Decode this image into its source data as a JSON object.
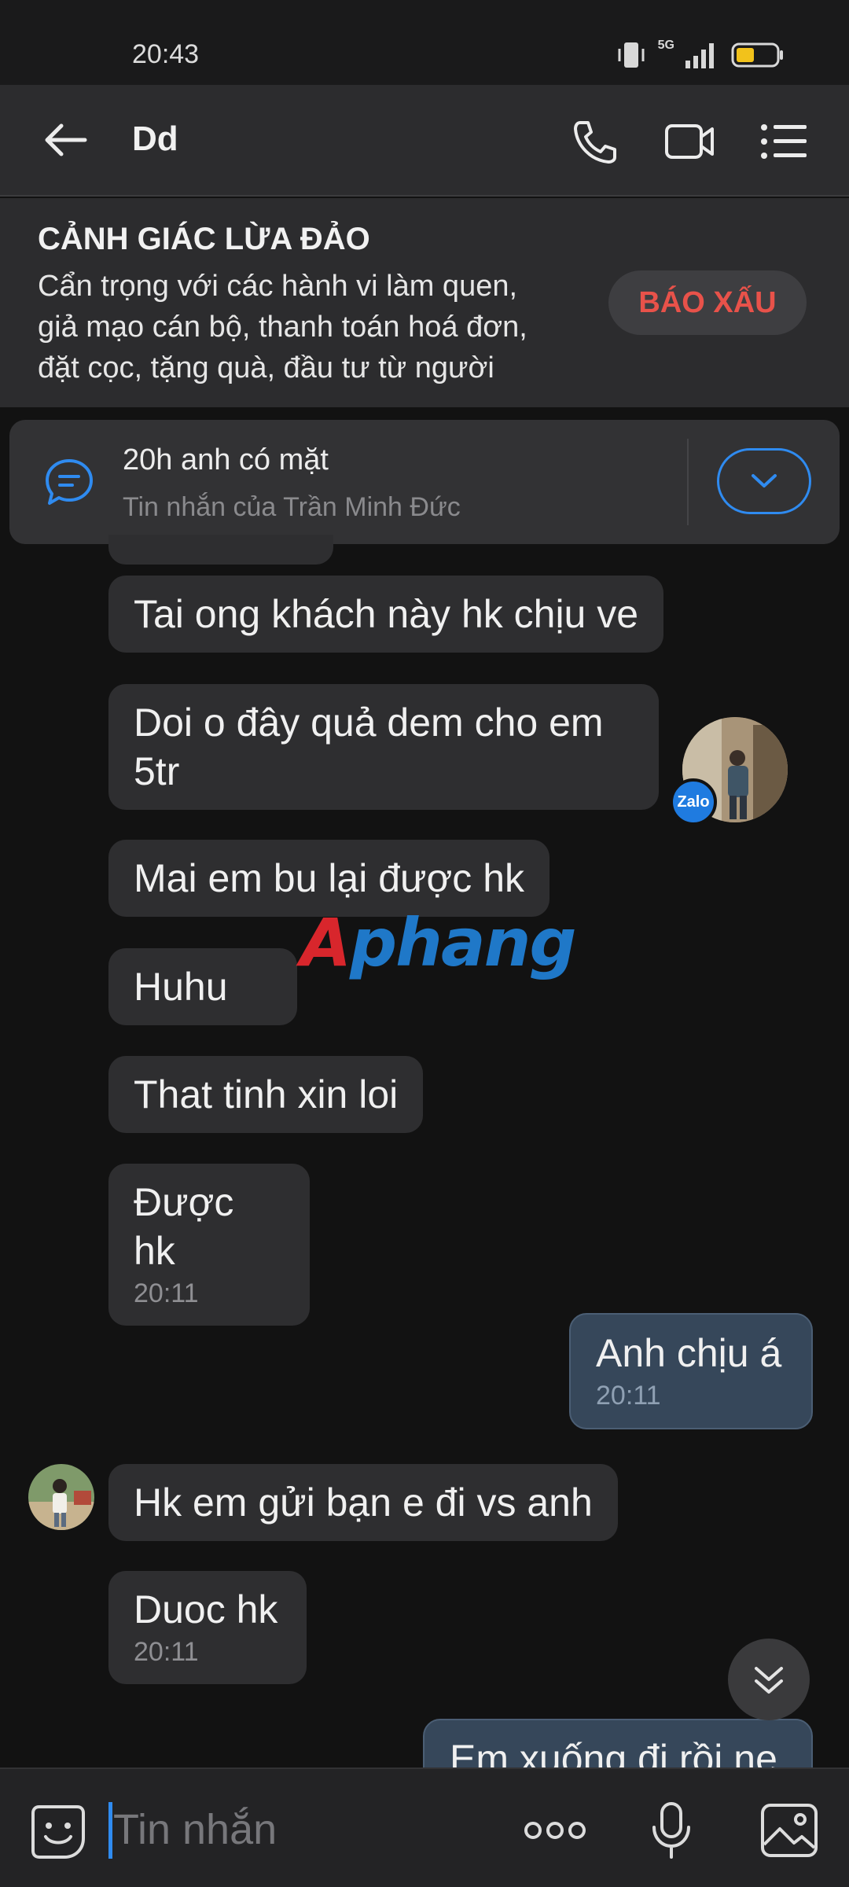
{
  "status_bar": {
    "time": "20:43",
    "network": "5G"
  },
  "header": {
    "title": "Dd"
  },
  "warning": {
    "title": "CẢNH GIÁC LỪA ĐẢO",
    "line1": "Cẩn trọng với các hành vi làm quen,",
    "line2": "giả mạo cán bộ, thanh toán hoá đơn,",
    "line3": "đặt cọc, tặng quà, đầu tư từ người",
    "report_label": "BÁO XẤU"
  },
  "pinned": {
    "title": "20h anh có mặt",
    "subtitle": "Tin nhắn của Trần Minh Đức"
  },
  "messages": [
    {
      "text": "Tai ong khách này hk chịu ve"
    },
    {
      "text": "Doi o đây quả dem cho em",
      "text2": "5tr",
      "badge": "Zalo"
    },
    {
      "text": "Mai em bu lại được hk"
    },
    {
      "text": "Huhu"
    },
    {
      "text": "That tinh xin loi"
    },
    {
      "text": "Được hk",
      "time": "20:11"
    },
    {
      "text": "Anh chịu á",
      "time": "20:11"
    },
    {
      "text": "Hk em gửi bạn e đi vs anh"
    },
    {
      "text": "Duoc hk",
      "time": "20:11"
    },
    {
      "text": "Em xuống đi rồi ne"
    }
  ],
  "watermark": {
    "a": "A",
    "rest": "phang"
  },
  "input": {
    "placeholder": "Tin nhắn"
  },
  "colors": {
    "accent": "#2f8bf0",
    "danger": "#e8524a",
    "incoming": "#2e2e30",
    "outgoing": "#36475a"
  }
}
